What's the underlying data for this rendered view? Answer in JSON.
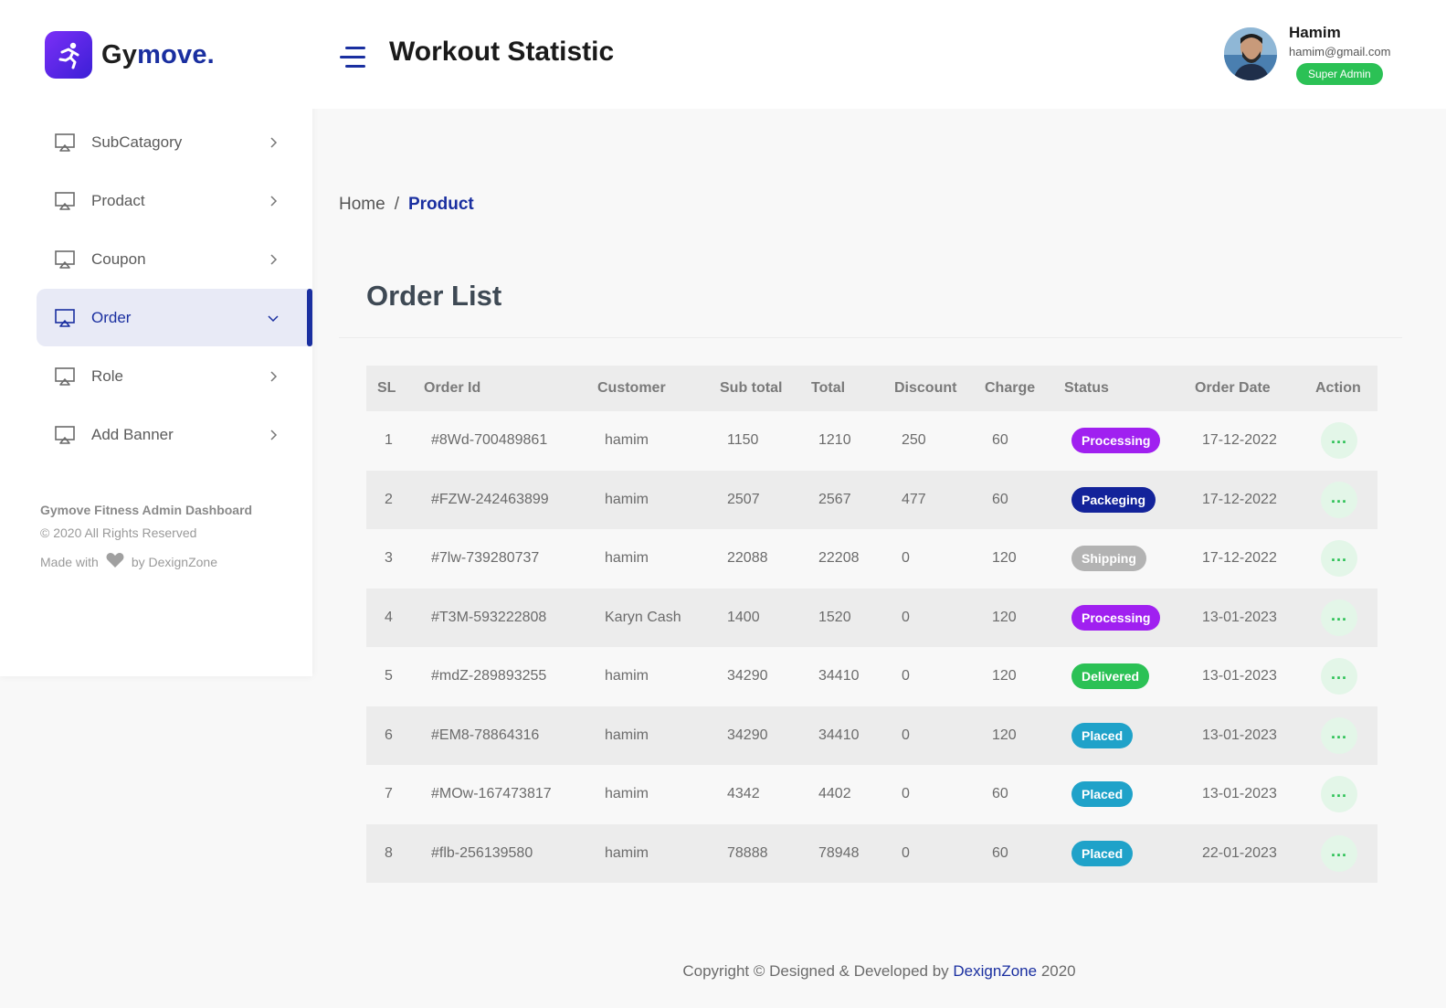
{
  "logo": {
    "part1": "Gy",
    "part2": "move."
  },
  "sidebar": {
    "items": [
      {
        "label": "SubCatagory",
        "icon": "monitor-icon",
        "active": false
      },
      {
        "label": "Prodact",
        "icon": "monitor-icon",
        "active": false
      },
      {
        "label": "Coupon",
        "icon": "monitor-icon",
        "active": false
      },
      {
        "label": "Order",
        "icon": "monitor-icon",
        "active": true
      },
      {
        "label": "Role",
        "icon": "monitor-icon",
        "active": false
      },
      {
        "label": "Add Banner",
        "icon": "monitor-icon",
        "active": false
      }
    ],
    "footer": {
      "title": "Gymove Fitness Admin Dashboard",
      "rights": "© 2020 All Rights Reserved",
      "made_with": "Made with",
      "by": "by DexignZone"
    }
  },
  "header": {
    "title": "Workout Statistic",
    "user": {
      "name": "Hamim",
      "email": "hamim@gmail.com",
      "role": "Super Admin"
    }
  },
  "breadcrumb": {
    "home": "Home",
    "separator": "/",
    "current": "Product"
  },
  "card": {
    "title": "Order List"
  },
  "table": {
    "columns": [
      "SL",
      "Order Id",
      "Customer",
      "Sub total",
      "Total",
      "Discount",
      "Charge",
      "Status",
      "Order Date",
      "Action"
    ],
    "rows": [
      {
        "sl": "1",
        "order_id": "#8Wd-700489861",
        "customer": "hamim",
        "sub_total": "1150",
        "total": "1210",
        "discount": "250",
        "charge": "60",
        "status": "Processing",
        "status_color": "#a020f0",
        "date": "17-12-2022"
      },
      {
        "sl": "2",
        "order_id": "#FZW-242463899",
        "customer": "hamim",
        "sub_total": "2507",
        "total": "2567",
        "discount": "477",
        "charge": "60",
        "status": "Packeging",
        "status_color": "#13239a",
        "date": "17-12-2022"
      },
      {
        "sl": "3",
        "order_id": "#7lw-739280737",
        "customer": "hamim",
        "sub_total": "22088",
        "total": "22208",
        "discount": "0",
        "charge": "120",
        "status": "Shipping",
        "status_color": "#b3b3b3",
        "date": "17-12-2022"
      },
      {
        "sl": "4",
        "order_id": "#T3M-593222808",
        "customer": "Karyn Cash",
        "sub_total": "1400",
        "total": "1520",
        "discount": "0",
        "charge": "120",
        "status": "Processing",
        "status_color": "#a020f0",
        "date": "13-01-2023"
      },
      {
        "sl": "5",
        "order_id": "#mdZ-289893255",
        "customer": "hamim",
        "sub_total": "34290",
        "total": "34410",
        "discount": "0",
        "charge": "120",
        "status": "Delivered",
        "status_color": "#2bc155",
        "date": "13-01-2023"
      },
      {
        "sl": "6",
        "order_id": "#EM8-78864316",
        "customer": "hamim",
        "sub_total": "34290",
        "total": "34410",
        "discount": "0",
        "charge": "120",
        "status": "Placed",
        "status_color": "#1fa2c9",
        "date": "13-01-2023"
      },
      {
        "sl": "7",
        "order_id": "#MOw-167473817",
        "customer": "hamim",
        "sub_total": "4342",
        "total": "4402",
        "discount": "0",
        "charge": "60",
        "status": "Placed",
        "status_color": "#1fa2c9",
        "date": "13-01-2023"
      },
      {
        "sl": "8",
        "order_id": "#flb-256139580",
        "customer": "hamim",
        "sub_total": "78888",
        "total": "78948",
        "discount": "0",
        "charge": "60",
        "status": "Placed",
        "status_color": "#1fa2c9",
        "date": "22-01-2023"
      }
    ]
  },
  "footer": {
    "text": "Copyright © Designed & Developed by",
    "brand": "DexignZone",
    "year": "2020"
  },
  "colors": {
    "primary": "#1a2fa0",
    "success": "#2bc155",
    "purple": "#a020f0",
    "cyan": "#1fa2c9"
  }
}
